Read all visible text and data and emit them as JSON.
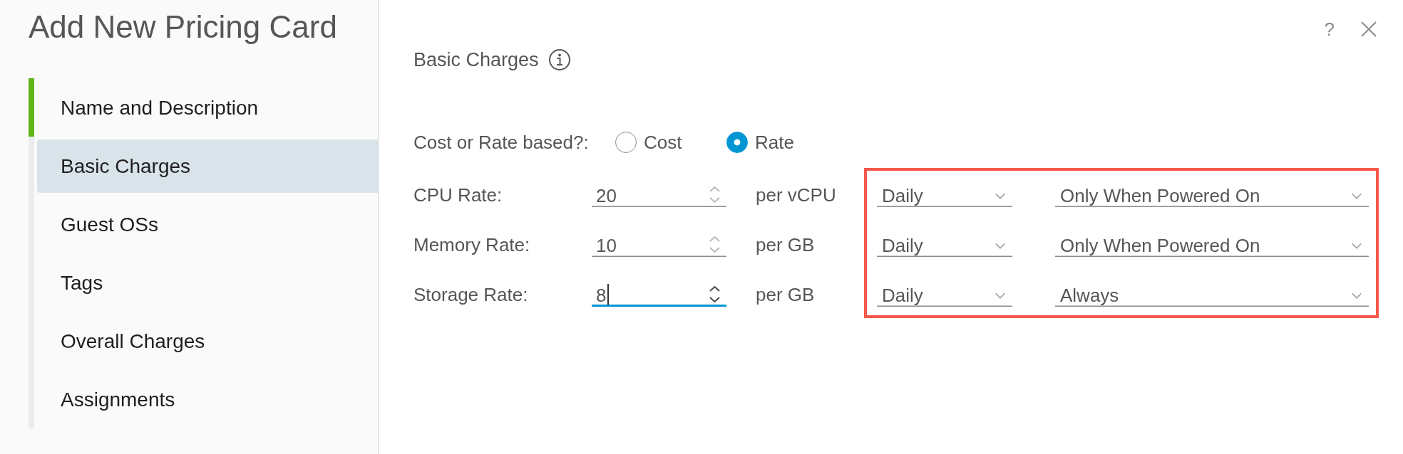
{
  "dialog": {
    "title": "Add New Pricing Card",
    "help_label": "?"
  },
  "steps": [
    {
      "label": "Name and Description",
      "completed": true,
      "selected": false
    },
    {
      "label": "Basic Charges",
      "completed": false,
      "selected": true
    },
    {
      "label": "Guest OSs",
      "completed": false,
      "selected": false
    },
    {
      "label": "Tags",
      "completed": false,
      "selected": false
    },
    {
      "label": "Overall Charges",
      "completed": false,
      "selected": false
    },
    {
      "label": "Assignments",
      "completed": false,
      "selected": false
    }
  ],
  "section": {
    "title": "Basic Charges"
  },
  "charge_basis": {
    "label": "Cost or Rate based?:",
    "options": [
      {
        "label": "Cost",
        "selected": false
      },
      {
        "label": "Rate",
        "selected": true
      }
    ]
  },
  "rates": [
    {
      "label": "CPU Rate:",
      "value": "20",
      "focused": false,
      "unit": "per vCPU",
      "period": "Daily",
      "condition": "Only When Powered On"
    },
    {
      "label": "Memory Rate:",
      "value": "10",
      "focused": false,
      "unit": "per GB",
      "period": "Daily",
      "condition": "Only When Powered On"
    },
    {
      "label": "Storage Rate:",
      "value": "8",
      "focused": true,
      "unit": "per GB",
      "period": "Daily",
      "condition": "Always"
    }
  ]
}
